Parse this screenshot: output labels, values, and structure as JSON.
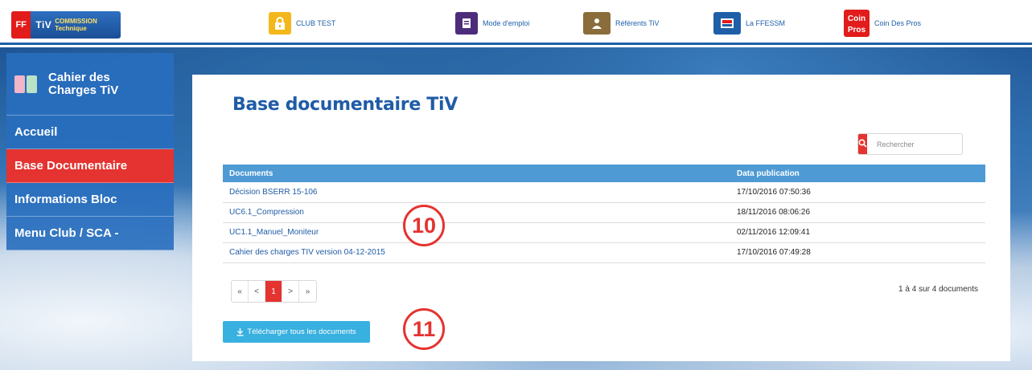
{
  "header": {
    "logo_text": "TiV",
    "logo_sub": "COMMISSION Technique",
    "nav": [
      {
        "label": "CLUB TEST",
        "icon": "lock-icon",
        "color": "#f3b71b"
      },
      {
        "label": "Mode d'emploi",
        "icon": "document-icon",
        "color": "#4e2c7c"
      },
      {
        "label": "Référents TiV",
        "icon": "person-icon",
        "color": "#8a6d3b"
      },
      {
        "label": "La FFESSM",
        "icon": "ffessm-logo-icon",
        "color": "#1e5fa8"
      },
      {
        "label": "Coin Des Pros",
        "icon": "coin-pros-icon",
        "color": "#e21b1b"
      }
    ]
  },
  "sidebar": {
    "title": "Cahier des Charges TiV",
    "items": [
      {
        "label": "Accueil",
        "active": false
      },
      {
        "label": "Base Documentaire",
        "active": true
      },
      {
        "label": "Informations Bloc",
        "active": false
      },
      {
        "label": "Menu Club / SCA -",
        "active": false
      }
    ]
  },
  "main": {
    "title": "Base documentaire TiV",
    "search": {
      "placeholder": "Rechercher"
    },
    "table": {
      "headers": [
        "Documents",
        "Data publication"
      ],
      "rows": [
        {
          "name": "Décision BSERR 15-106",
          "date": "17/10/2016 07:50:36"
        },
        {
          "name": "UC6.1_Compression",
          "date": "18/11/2016 08:06:26"
        },
        {
          "name": "UC1.1_Manuel_Moniteur",
          "date": "02/11/2016 12:09:41"
        },
        {
          "name": "Cahier des charges TIV version 04-12-2015",
          "date": "17/10/2016 07:49:28"
        }
      ]
    },
    "pagination": {
      "first": "«",
      "prev": "<",
      "current": "1",
      "next": ">",
      "last": "»"
    },
    "counter": "1 à 4 sur 4 documents",
    "download_label": "Télécharger tous les documents"
  },
  "callouts": [
    "10",
    "11"
  ],
  "colors": {
    "primary": "#1e5fa8",
    "accent": "#e43330",
    "header_row": "#4e9ad4",
    "button": "#38b0e0"
  }
}
